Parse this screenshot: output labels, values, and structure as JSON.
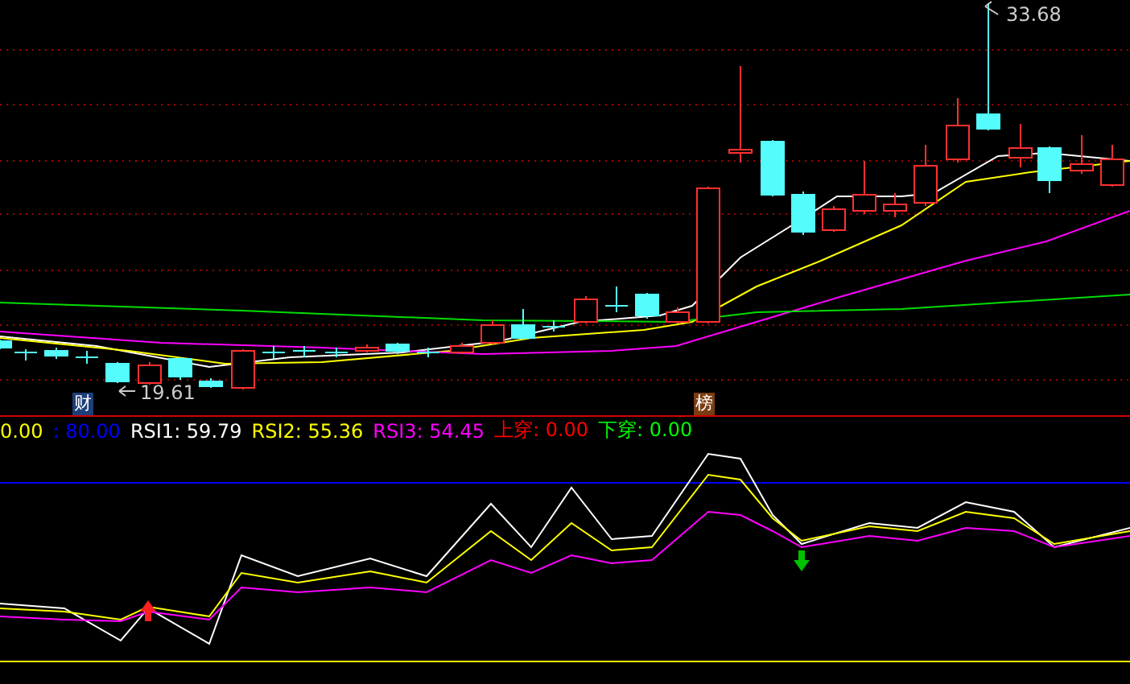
{
  "price_chart": {
    "high_label": "33.68",
    "low_label": "19.61",
    "markers": [
      {
        "label": "财",
        "color": "#1c3f78"
      },
      {
        "label": "榜",
        "color": "#7a3d12"
      }
    ]
  },
  "indicator": {
    "legend": [
      {
        "text": "0.00",
        "color": "#ffff00"
      },
      {
        "text": ": 80.00",
        "color": "#0000ff"
      },
      {
        "text": "RSI1: 59.79",
        "color": "#ffffff"
      },
      {
        "text": "RSI2: 55.36",
        "color": "#ffff00"
      },
      {
        "text": "RSI3: 54.45",
        "color": "#ff00ff"
      },
      {
        "text": "上穿: 0.00",
        "color": "#ff0000"
      },
      {
        "text": "下穿: 0.00",
        "color": "#00ff00"
      }
    ]
  }
}
